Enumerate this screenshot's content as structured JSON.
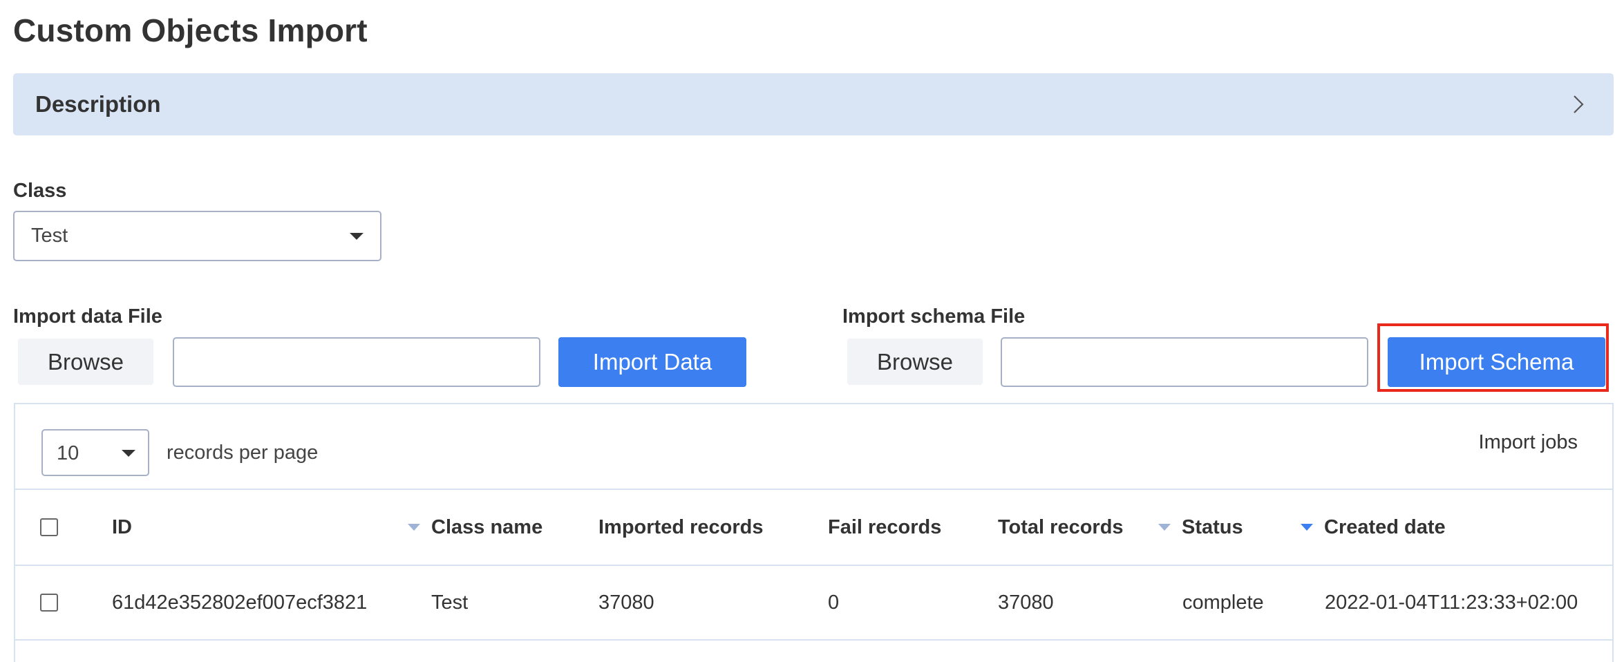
{
  "page": {
    "title": "Custom Objects Import"
  },
  "description": {
    "label": "Description",
    "icon": "chevron-right-icon"
  },
  "class_field": {
    "label": "Class",
    "selected": "Test"
  },
  "import_data": {
    "label": "Import data File",
    "browse_label": "Browse",
    "file_value": "",
    "button_label": "Import Data"
  },
  "import_schema": {
    "label": "Import schema File",
    "browse_label": "Browse",
    "file_value": "",
    "button_label": "Import Schema"
  },
  "table": {
    "per_page_value": "10",
    "per_page_label": "records per page",
    "title": "Import jobs",
    "columns": {
      "id": "ID",
      "class_name": "Class name",
      "imported_records": "Imported records",
      "fail_records": "Fail records",
      "total_records": "Total records",
      "status": "Status",
      "created_date": "Created date"
    },
    "rows": [
      {
        "id": "61d42e352802ef007ecf3821",
        "class_name": "Test",
        "imported_records": "37080",
        "fail_records": "0",
        "total_records": "37080",
        "status": "complete",
        "created_date": "2022-01-04T11:23:33+02:00"
      }
    ]
  },
  "colors": {
    "primary": "#3b7ff0",
    "description_bg": "#d9e4f5",
    "highlight": "#e8291b",
    "border": "#a6b1c8"
  }
}
